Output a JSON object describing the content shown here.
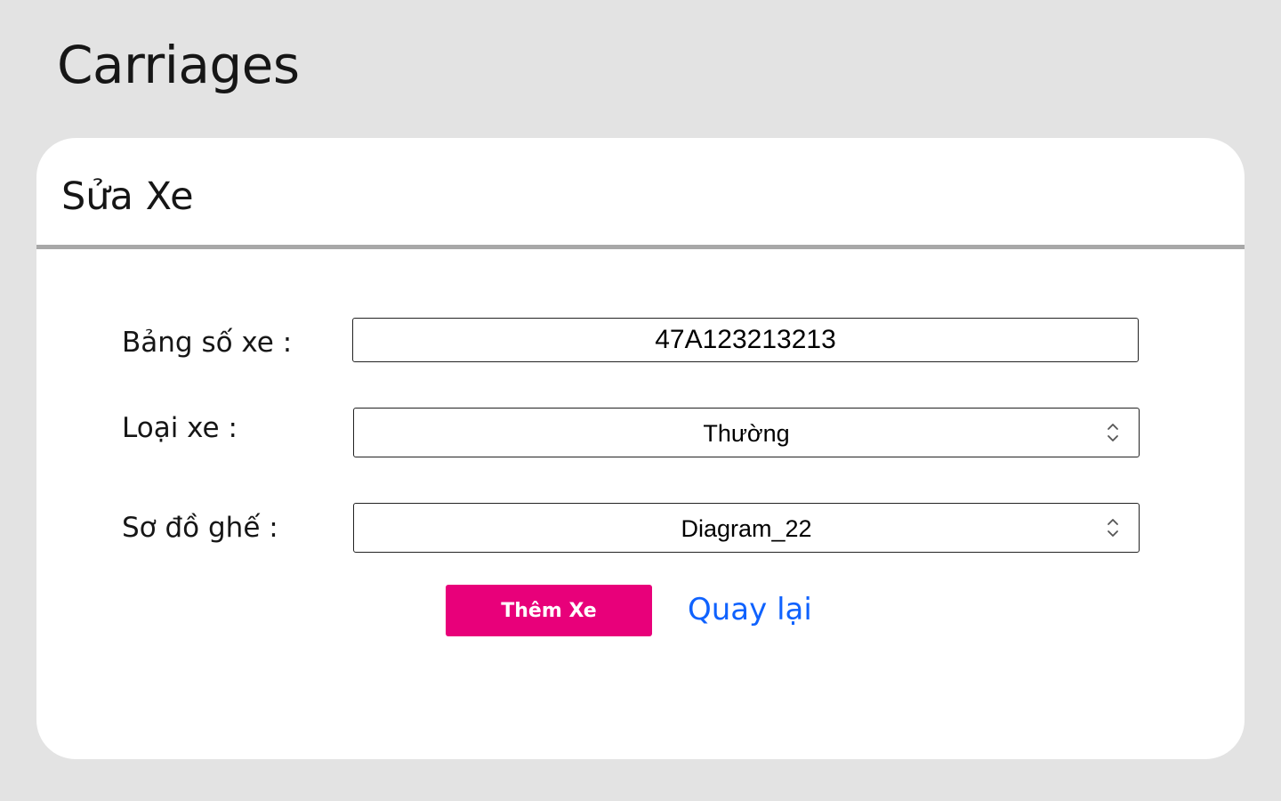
{
  "page": {
    "title": "Carriages"
  },
  "card": {
    "title": "Sửa Xe"
  },
  "form": {
    "plate_label": "Bảng số xe :",
    "plate_value": "47A123213213",
    "type_label": "Loại xe :",
    "type_value": "Thường",
    "seatmap_label": "Sơ đồ ghế :",
    "seatmap_value": "Diagram_22"
  },
  "actions": {
    "submit_label": "Thêm Xe",
    "back_label": "Quay lại"
  },
  "icons": {
    "select_arrows": "up-down-chevron-icon"
  },
  "colors": {
    "background": "#e3e3e3",
    "card": "#ffffff",
    "divider": "#a8a8a8",
    "primary_button": "#e8007a",
    "link": "#0f62fe"
  }
}
